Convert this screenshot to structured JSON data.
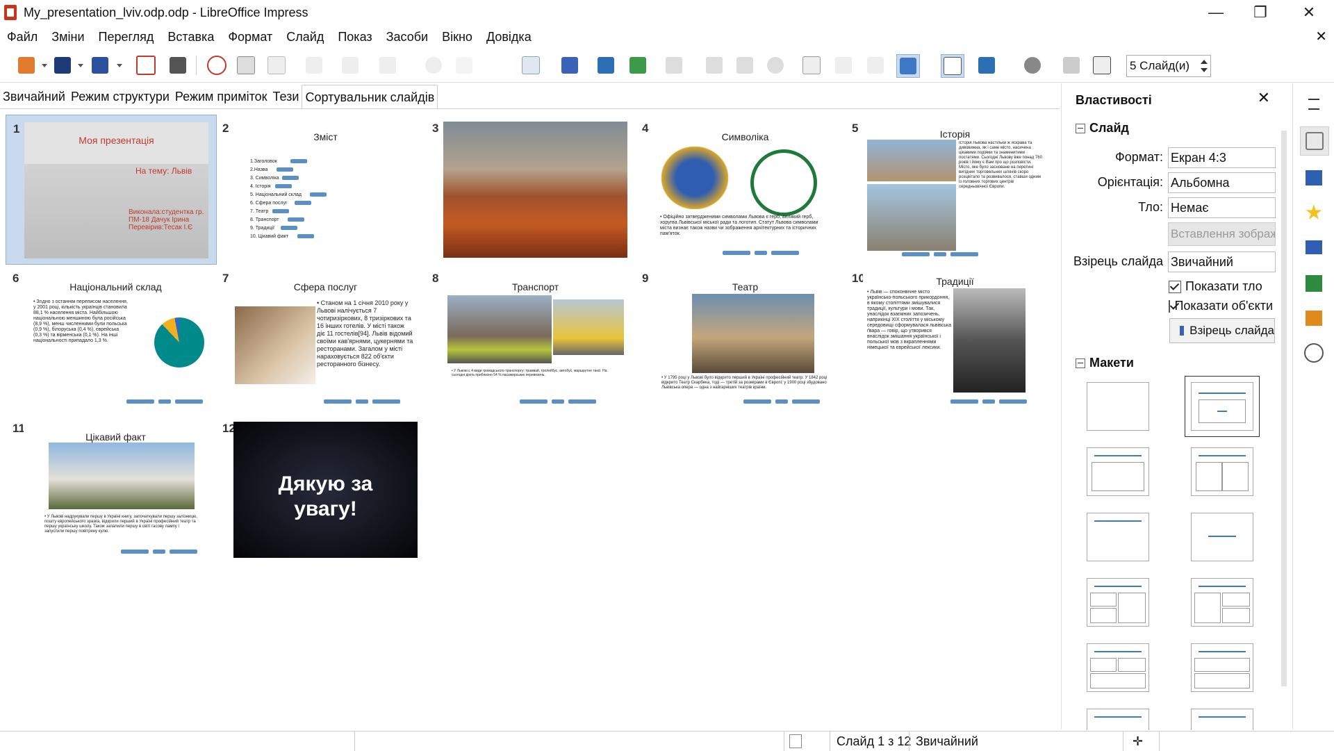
{
  "window": {
    "title": "My_presentation_lviv.odp.odp - LibreOffice Impress",
    "minimize": "—",
    "restore": "❐",
    "close": "✕"
  },
  "menu": [
    "Файл",
    "Зміни",
    "Перегляд",
    "Вставка",
    "Формат",
    "Слайд",
    "Показ",
    "Засоби",
    "Вікно",
    "Довідка"
  ],
  "menu_close": "✕",
  "toolbar": {
    "slides_per_row": "5 Слайд(и)"
  },
  "tabs": [
    "Звичайний",
    "Режим структури",
    "Режим приміток",
    "Тези",
    "Сортувальник слайдів"
  ],
  "slides": {
    "s1": {
      "num": "1",
      "title": "Моя презентація",
      "subtitle": "На тему: Львів",
      "author": "Виконала:студентка гр. ПМ-18 Дачук Ірина Перевірив:Тесак І.Є"
    },
    "s2": {
      "num": "2",
      "title": "Зміст",
      "items": [
        "1.Заголовок",
        "2.Назва",
        "3. Символіка",
        "4. Історія",
        "5. Національний склад",
        "6. Сфера послуг",
        "7. Театр",
        "8. Транспорт",
        "9. Традиції",
        "10. Цікавий факт"
      ]
    },
    "s3": {
      "num": "3"
    },
    "s4": {
      "num": "4",
      "title": "Символіка",
      "text": "• Офіційно затвердженими символами Львова є герб, великий герб, хоругва Львівської міської ради та логотип. Статут Львова символами міста визнає також назви чи зображення архітектурних та історичних пам'яток."
    },
    "s5": {
      "num": "5",
      "title": "Історія",
      "text": "Історія Львова настільки ж яскрава та дивовижна, як і саме місто, насичена цікавими подіями та знаменитими постатями. Сьогодні Львову вже понад 760 років і йому є Вам про що розповісти. Місто, яке було засноване на перетині вигідних торговельних шляхів скоро розцвітало та розвивалося, ставши одним із головних торгових центрів середньовічної Європи."
    },
    "s6": {
      "num": "6",
      "title": "Національний склад",
      "text": "• Згідно з останнім переписом населення, у 2001 році, кількість українців становила 88,1 % населення міста. Найбільшою національною меншиною була російська (8,9 %), менш численними були польська (0,9 %), білоруська (0,4 %), єврейська (0,3 %) та вірменська (0,1 %). На інші національності припадало 1,3 %."
    },
    "s7": {
      "num": "7",
      "title": "Сфера послуг",
      "text": "• Станом на 1 січня 2010 року у Львові налічується 7 чотиризіркових, 8 тризіркових та 16 інших готелів. У місті також діє 11 гостелів[94]. Львів відомий своїми кав'ярнями, цукернями та ресторанами. Загалом у місті нараховується 822 об'єкти ресторанного бізнесу."
    },
    "s8": {
      "num": "8",
      "title": "Транспорт",
      "text": "• У Львові є 4 види громадського транспорту: трамвай, тролейбус, автобус, маршрутне таксі. На сьогодні діють приблизно 54 % пасажирських перевезень."
    },
    "s9": {
      "num": "9",
      "title": "Театр",
      "text": "• У 1795 році у Львові було відкрито перший в Україні професійний театр. У 1842 році відкрито Театр Скарбека, тоді — третій за розмірами в Європі; у 1900 році збудовано Львівська опера — одна з найгарніших театрів країни."
    },
    "s10": {
      "num": "10",
      "title": "Традиції",
      "text": "• Львів — споконвічне місто українсько-польського прикордоння, в якому століттями змішувалися традиції, культури і мови. Так, унаслідок взаємних запозичень, наприкінці XIX століття у міському середовищі сформувалася львівська ґвара — говір, що утворився внаслідок змішання української і польської мов з вкрапленнями німецької та єврейської лексики."
    },
    "s11": {
      "num": "11",
      "title": "Цікавий факт",
      "text": "• У Львові надрукували першу в Україні книгу, започаткували першу залізницю, пошту європейського зразка, відкрили перший в Україні професійний театр та першу українську школу. Також запалили першу в світі гасову лампу і запустили першу повітряну кулю."
    },
    "s12": {
      "num": "12",
      "title": "Дякую за увагу!"
    }
  },
  "sidebar": {
    "title": "Властивості",
    "section_slide": "Слайд",
    "format_label": "Формат:",
    "format_value": "Екран 4:3",
    "orientation_label": "Орієнтація:",
    "orientation_value": "Альбомна",
    "background_label": "Тло:",
    "background_value": "Немає",
    "insert_image": "Вставлення зображення",
    "master_label": "Взірець слайда",
    "master_value": "Звичайний",
    "show_background": "Показати тло",
    "show_objects": "Показати об'єкти",
    "master_button": "Взірець слайда",
    "section_layouts": "Макети"
  },
  "status": {
    "slide": "Слайд 1 з 12",
    "master": "Звичайний"
  },
  "colors": {
    "accent": "#3d78c6",
    "selection": "#c9d9ee",
    "title_red": "#c0392b"
  }
}
